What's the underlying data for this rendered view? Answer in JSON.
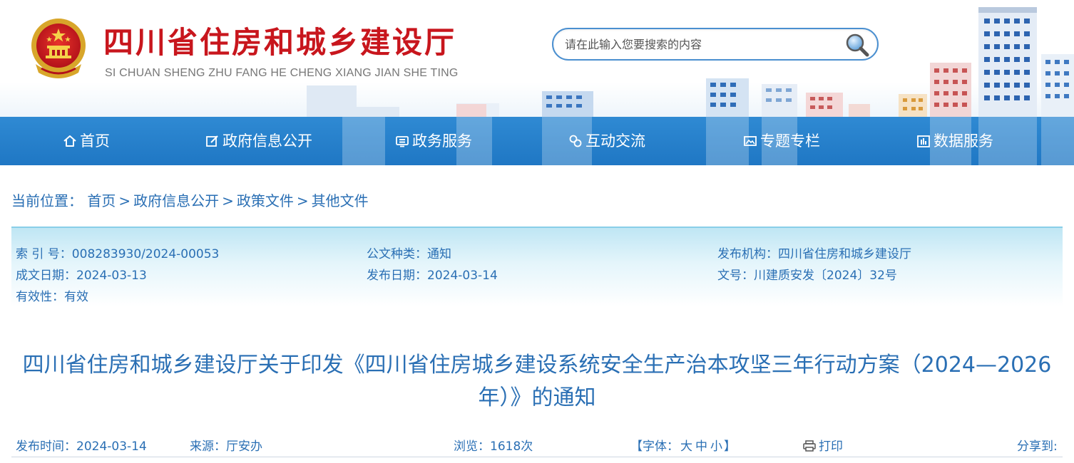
{
  "header": {
    "title": "四川省住房和城乡建设厅",
    "subtitle": "SI CHUAN SHENG ZHU FANG HE CHENG XIANG JIAN SHE TING",
    "search_placeholder": "请在此输入您要搜索的内容"
  },
  "nav": {
    "items": [
      {
        "label": "首页",
        "icon": "home-icon"
      },
      {
        "label": "政府信息公开",
        "icon": "edit-icon"
      },
      {
        "label": "政务服务",
        "icon": "monitor-icon"
      },
      {
        "label": "互动交流",
        "icon": "chat-icon"
      },
      {
        "label": "专题专栏",
        "icon": "image-icon"
      },
      {
        "label": "数据服务",
        "icon": "chart-icon"
      }
    ]
  },
  "breadcrumb": {
    "label": "当前位置：",
    "sep": ">",
    "items": [
      "首页",
      "政府信息公开",
      "政策文件",
      "其他文件"
    ]
  },
  "meta": {
    "index_no": "索 引 号：008283930/2024-00053",
    "doc_type": "公文种类：通知",
    "publisher": "发布机构：四川省住房和城乡建设厅",
    "created_date": "成文日期：2024-03-13",
    "publish_date": "发布日期：2024-03-14",
    "doc_no": "文号：川建质安发〔2024〕32号",
    "validity": "有效性：有效"
  },
  "article": {
    "title": "四川省住房和城乡建设厅关于印发《四川省住房城乡建设系统安全生产治本攻坚三年行动方案（2024—2026年）》的通知"
  },
  "info": {
    "publish_time": "发布时间：2024-03-14",
    "source": "来源：厅安办",
    "views": "浏览：1618次",
    "font_label_open": "【字体：",
    "font_large": "大",
    "font_medium": "中",
    "font_small": "小",
    "font_label_close": "】",
    "print": "打印",
    "share": "分享到:"
  },
  "colors": {
    "brand_red": "#c8161d",
    "nav_blue": "#1f77c4",
    "text_blue": "#2a6fb4"
  }
}
